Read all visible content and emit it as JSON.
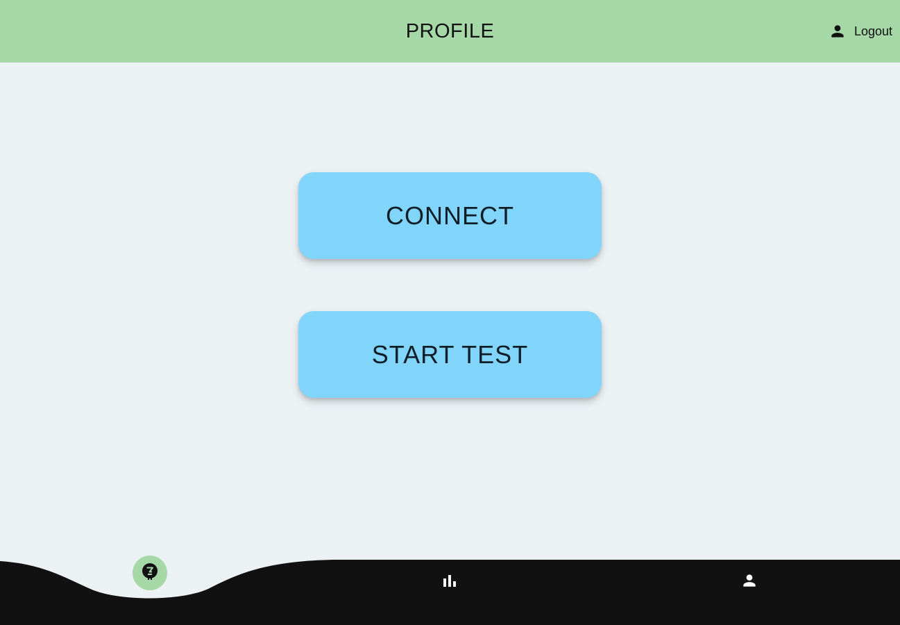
{
  "header": {
    "title": "PROFILE",
    "logout_label": "Logout",
    "logout_icon": "person-icon"
  },
  "main": {
    "connect_label": "CONNECT",
    "start_test_label": "START TEST"
  },
  "bottom_nav": {
    "items": [
      {
        "icon": "test-badge-icon",
        "active": true
      },
      {
        "icon": "bar-chart-icon",
        "active": false
      },
      {
        "icon": "person-icon",
        "active": false
      }
    ]
  },
  "colors": {
    "header_bg": "#a5d7a7",
    "page_bg": "#ecf1f4",
    "button_bg": "#81d4fa",
    "nav_bg": "#111111",
    "active_nav_bg": "#a5d7a7"
  }
}
